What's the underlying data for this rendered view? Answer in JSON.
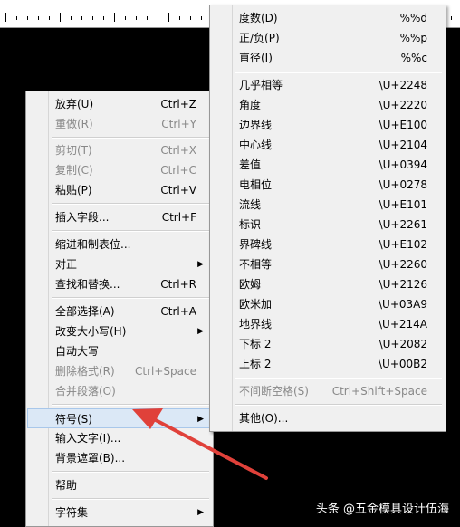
{
  "context_menu": {
    "items": [
      {
        "label": "放弃(U)",
        "shortcut": "Ctrl+Z"
      },
      {
        "label": "重做(R)",
        "shortcut": "Ctrl+Y"
      },
      {
        "label": "剪切(T)",
        "shortcut": "Ctrl+X"
      },
      {
        "label": "复制(C)",
        "shortcut": "Ctrl+C"
      },
      {
        "label": "粘贴(P)",
        "shortcut": "Ctrl+V"
      },
      {
        "label": "插入字段...",
        "shortcut": "Ctrl+F"
      },
      {
        "label": "缩进和制表位...",
        "shortcut": ""
      },
      {
        "label": "对正",
        "shortcut": ""
      },
      {
        "label": "查找和替换...",
        "shortcut": "Ctrl+R"
      },
      {
        "label": "全部选择(A)",
        "shortcut": "Ctrl+A"
      },
      {
        "label": "改变大小写(H)",
        "shortcut": ""
      },
      {
        "label": "自动大写",
        "shortcut": ""
      },
      {
        "label": "删除格式(R)",
        "shortcut": "Ctrl+Space"
      },
      {
        "label": "合并段落(O)",
        "shortcut": ""
      },
      {
        "label": "符号(S)",
        "shortcut": ""
      },
      {
        "label": "输入文字(I)...",
        "shortcut": ""
      },
      {
        "label": "背景遮罩(B)...",
        "shortcut": ""
      },
      {
        "label": "帮助",
        "shortcut": ""
      },
      {
        "label": "字符集",
        "shortcut": ""
      }
    ]
  },
  "symbol_menu": {
    "items": [
      {
        "label": "度数(D)",
        "code": "%%d"
      },
      {
        "label": "正/负(P)",
        "code": "%%p"
      },
      {
        "label": "直径(I)",
        "code": "%%c"
      },
      {
        "label": "几乎相等",
        "code": "\\U+2248"
      },
      {
        "label": "角度",
        "code": "\\U+2220"
      },
      {
        "label": "边界线",
        "code": "\\U+E100"
      },
      {
        "label": "中心线",
        "code": "\\U+2104"
      },
      {
        "label": "差值",
        "code": "\\U+0394"
      },
      {
        "label": "电相位",
        "code": "\\U+0278"
      },
      {
        "label": "流线",
        "code": "\\U+E101"
      },
      {
        "label": "标识",
        "code": "\\U+2261"
      },
      {
        "label": "界碑线",
        "code": "\\U+E102"
      },
      {
        "label": "不相等",
        "code": "\\U+2260"
      },
      {
        "label": "欧姆",
        "code": "\\U+2126"
      },
      {
        "label": "欧米加",
        "code": "\\U+03A9"
      },
      {
        "label": "地界线",
        "code": "\\U+214A"
      },
      {
        "label": "下标 2",
        "code": "\\U+2082"
      },
      {
        "label": "上标 2",
        "code": "\\U+00B2"
      },
      {
        "label": "不间断空格(S)",
        "code": "Ctrl+Shift+Space"
      },
      {
        "label": "其他(O)...",
        "code": ""
      }
    ]
  },
  "watermark": "头条 @五金模具设计伍海",
  "colors": {
    "arrow": "#e0413a",
    "hover": "#dbe8f6"
  }
}
